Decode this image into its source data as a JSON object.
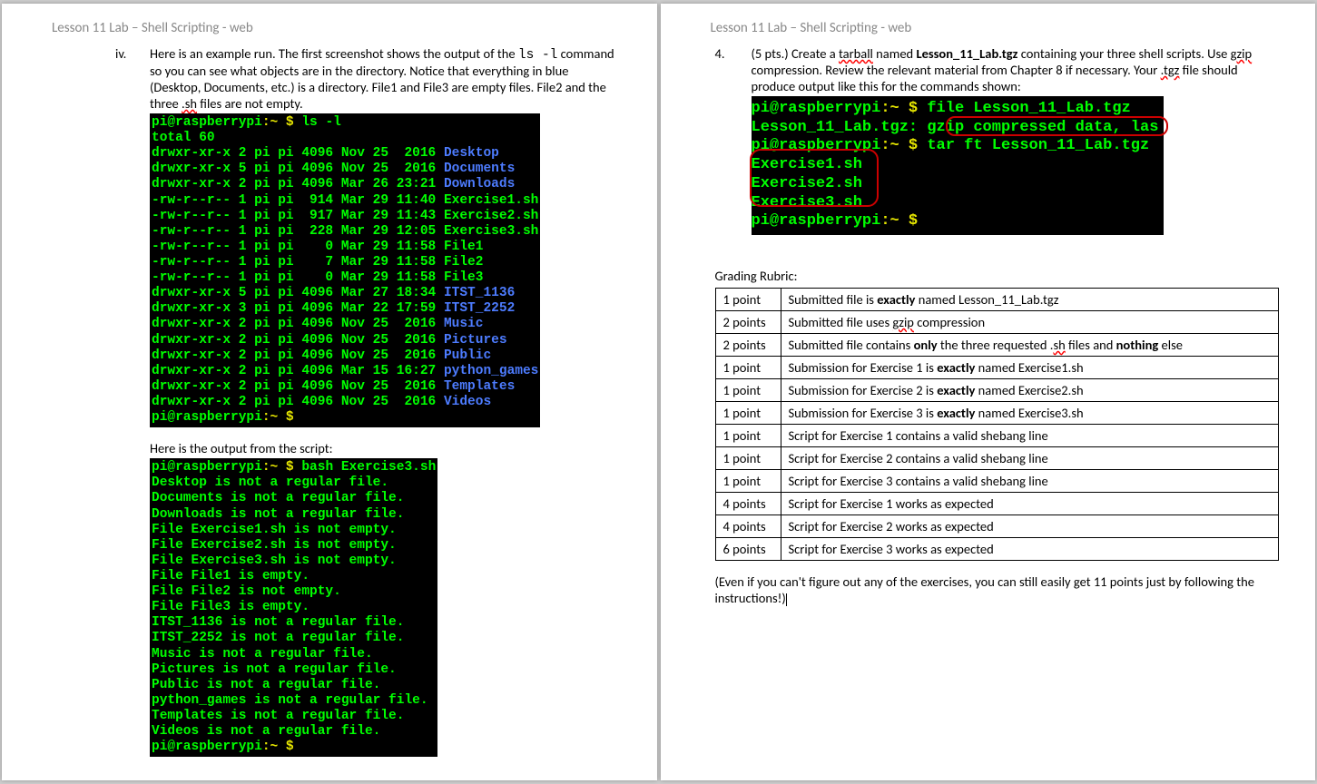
{
  "header": "Lesson 11 Lab – Shell Scripting - web",
  "left": {
    "bullet": "iv.",
    "intro1a": "Here is an example run.  The first screenshot shows the output of the ",
    "intro_code": "ls  -l",
    "intro1b": " command so you can see what objects are in the directory.  Notice that everything in blue (Desktop, Documents, etc.) is a directory.  File1 and File3 are empty files.  File2 and the three ",
    "intro_sh": ".sh",
    "intro1c": " files are not empty.",
    "terminal1": {
      "prompt_user": "pi@raspberrypi",
      "prompt_path": ":~ $ ",
      "cmd": "ls -l",
      "lines": [
        {
          "p": "total 60"
        },
        {
          "p": "drwxr-xr-x 2 pi pi 4096 Nov 25  2016 ",
          "n": "Desktop",
          "c": "b"
        },
        {
          "p": "drwxr-xr-x 5 pi pi 4096 Nov 25  2016 ",
          "n": "Documents",
          "c": "b"
        },
        {
          "p": "drwxr-xr-x 2 pi pi 4096 Mar 26 23:21 ",
          "n": "Downloads",
          "c": "b"
        },
        {
          "p": "-rw-r--r-- 1 pi pi  914 Mar 29 11:40 ",
          "n": "Exercise1.sh",
          "c": "g"
        },
        {
          "p": "-rw-r--r-- 1 pi pi  917 Mar 29 11:43 ",
          "n": "Exercise2.sh",
          "c": "g"
        },
        {
          "p": "-rw-r--r-- 1 pi pi  228 Mar 29 12:05 ",
          "n": "Exercise3.sh",
          "c": "g"
        },
        {
          "p": "-rw-r--r-- 1 pi pi    0 Mar 29 11:58 ",
          "n": "File1",
          "c": "g"
        },
        {
          "p": "-rw-r--r-- 1 pi pi    7 Mar 29 11:58 ",
          "n": "File2",
          "c": "g"
        },
        {
          "p": "-rw-r--r-- 1 pi pi    0 Mar 29 11:58 ",
          "n": "File3",
          "c": "g"
        },
        {
          "p": "drwxr-xr-x 5 pi pi 4096 Mar 27 18:34 ",
          "n": "ITST_1136",
          "c": "b"
        },
        {
          "p": "drwxr-xr-x 3 pi pi 4096 Mar 22 17:59 ",
          "n": "ITST_2252",
          "c": "b"
        },
        {
          "p": "drwxr-xr-x 2 pi pi 4096 Nov 25  2016 ",
          "n": "Music",
          "c": "b"
        },
        {
          "p": "drwxr-xr-x 2 pi pi 4096 Nov 25  2016 ",
          "n": "Pictures",
          "c": "b"
        },
        {
          "p": "drwxr-xr-x 2 pi pi 4096 Nov 25  2016 ",
          "n": "Public",
          "c": "b"
        },
        {
          "p": "drwxr-xr-x 2 pi pi 4096 Mar 15 16:27 ",
          "n": "python_games",
          "c": "b"
        },
        {
          "p": "drwxr-xr-x 2 pi pi 4096 Nov 25  2016 ",
          "n": "Templates",
          "c": "b"
        },
        {
          "p": "drwxr-xr-x 2 pi pi 4096 Nov 25  2016 ",
          "n": "Videos",
          "c": "b"
        }
      ]
    },
    "intro2": "Here is the output from the script:",
    "terminal2": {
      "prompt_user": "pi@raspberrypi",
      "prompt_path": ":~ $ ",
      "cmd": "bash Exercise3.sh",
      "lines": [
        "Desktop is not a regular file.",
        "Documents is not a regular file.",
        "Downloads is not a regular file.",
        "File Exercise1.sh is not empty.",
        "File Exercise2.sh is not empty.",
        "File Exercise3.sh is not empty.",
        "File File1 is empty.",
        "File File2 is not empty.",
        "File File3 is empty.",
        "ITST_1136 is not a regular file.",
        "ITST_2252 is not a regular file.",
        "Music is not a regular file.",
        "Pictures is not a regular file.",
        "Public is not a regular file.",
        "python_games is not a regular file.",
        "Templates is not a regular file.",
        "Videos is not a regular file."
      ]
    }
  },
  "right": {
    "num": "4.",
    "pts": "(5 pts.) Create a ",
    "tarball": "tarball",
    "text1": " named ",
    "bold1": "Lesson_11_Lab.tgz",
    "text2": " containing your three shell scripts.  Use ",
    "gzip": "gzip",
    "text3": " compression.  Review the relevant material from Chapter 8 if necessary.  Your ",
    "tgz": ".tgz",
    "text4": " file should produce output like this for the commands shown:",
    "terminal": {
      "l1_user": "pi@raspberrypi",
      "l1_path": ":~ $ ",
      "l1_cmd": "file Lesson_11_Lab.tgz",
      "l2": "Lesson_11_Lab.tgz: ",
      "l2_hi": "gzip compressed data",
      "l2_tail": ", las",
      "l3_user": "pi@raspberrypi",
      "l3_path": ":~ $ ",
      "l3_cmd": "tar ft Lesson_11_Lab.tgz",
      "l4": "Exercise1.sh",
      "l5": "Exercise2.sh",
      "l6": "Exercise3.sh",
      "l7_user": "pi@raspberrypi",
      "l7_path": ":~ $ "
    },
    "rubric_title": "Grading Rubric:",
    "rubric": [
      {
        "pts": "1 point",
        "txt": "Submitted file is <b>exactly</b> named Lesson_11_Lab.tgz"
      },
      {
        "pts": "2 points",
        "txt": "Submitted file uses <u>gzip</u> compression"
      },
      {
        "pts": "2 points",
        "txt": "Submitted file contains <b>only</b> the three requested .<u>sh</u> files and <b>nothing</b> else"
      },
      {
        "pts": "1 point",
        "txt": "Submission for Exercise 1 is <b>exactly</b> named Exercise1.sh"
      },
      {
        "pts": "1 point",
        "txt": "Submission for Exercise 2 is <b>exactly</b> named Exercise2.sh"
      },
      {
        "pts": "1 point",
        "txt": "Submission for Exercise 3 is <b>exactly</b> named Exercise3.sh"
      },
      {
        "pts": "1 point",
        "txt": "Script for Exercise 1 contains a valid shebang line"
      },
      {
        "pts": "1 point",
        "txt": "Script for Exercise 2 contains a valid shebang line"
      },
      {
        "pts": "1 point",
        "txt": "Script for Exercise 3 contains a valid shebang line"
      },
      {
        "pts": "4 points",
        "txt": "Script for Exercise 1 works as expected"
      },
      {
        "pts": "4 points",
        "txt": "Script for Exercise 2 works as expected"
      },
      {
        "pts": "6 points",
        "txt": "Script for Exercise 3 works as expected"
      }
    ],
    "footnote": "(Even if you can't figure out any of the exercises, you can still easily get 11 points just by following the instructions!)"
  }
}
